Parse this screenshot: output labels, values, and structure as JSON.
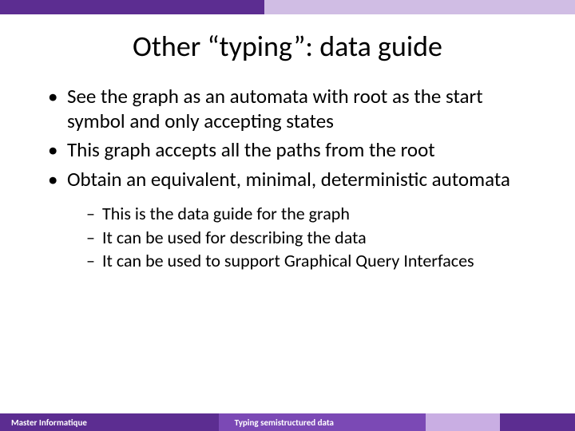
{
  "topbar": {
    "dark": "#5c2d91",
    "light": "#d0bde4"
  },
  "title": "Other “typing”: data guide",
  "bullets": [
    "See the graph as an automata with root as the start symbol and only accepting states",
    "This graph accepts all the paths from the root",
    "Obtain an equivalent, minimal, deterministic automata"
  ],
  "subbullets": [
    "This is the data guide for the graph",
    "It can be used for describing the data",
    "It can be used to support Graphical Query Interfaces"
  ],
  "footer": {
    "left": "Master Informatique",
    "center": "Typing semistructured data"
  }
}
